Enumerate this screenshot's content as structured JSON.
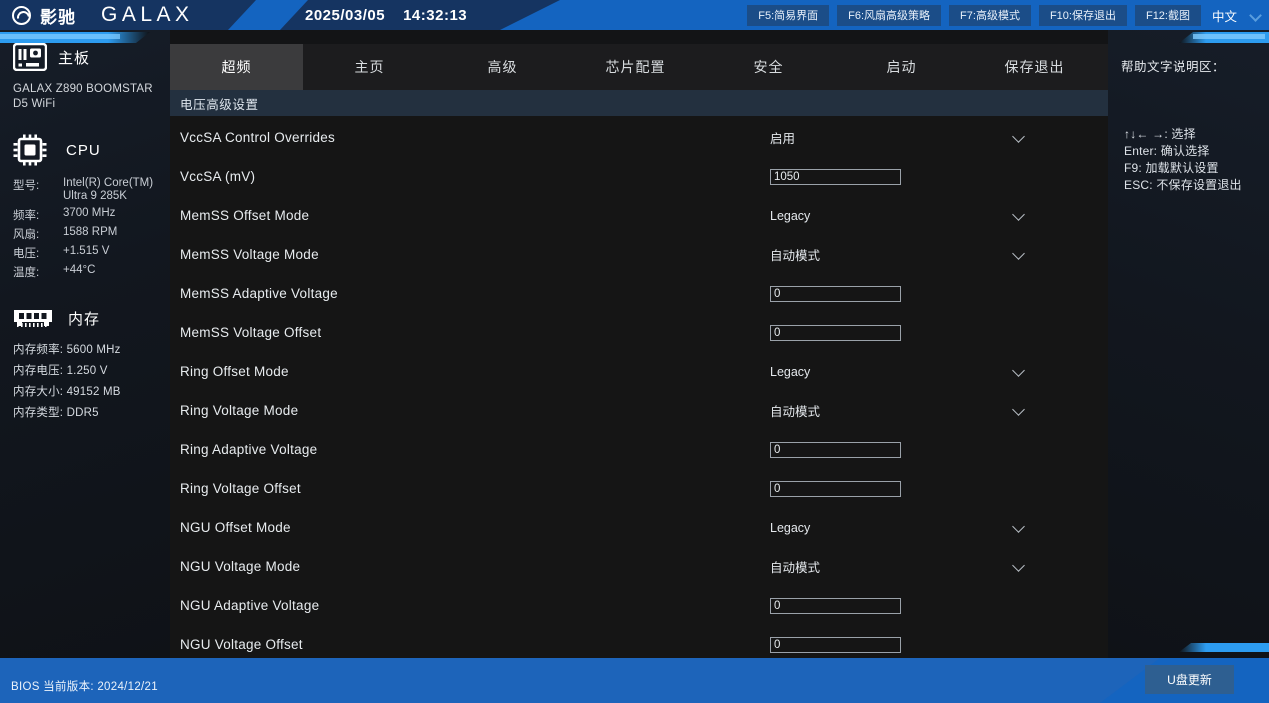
{
  "topbar": {
    "brand_cn": "影驰",
    "brand_en": "GALAX",
    "date": "2025/03/05",
    "time": "14:32:13",
    "fkeys": [
      {
        "label": "F5:简易界面"
      },
      {
        "label": "F6:风扇高级策略"
      },
      {
        "label": "F7:高级模式"
      },
      {
        "label": "F10:保存退出"
      },
      {
        "label": "F12:截图"
      }
    ],
    "language": "中文"
  },
  "sidebar": {
    "motherboard": {
      "title": "主板",
      "model": "GALAX Z890 BOOMSTAR D5 WiFi"
    },
    "cpu": {
      "title": "CPU",
      "rows": [
        {
          "key": "型号:",
          "value": "Intel(R) Core(TM) Ultra 9 285K"
        },
        {
          "key": "频率:",
          "value": "3700 MHz"
        },
        {
          "key": "风扇:",
          "value": "1588 RPM"
        },
        {
          "key": "电压:",
          "value": "+1.515 V"
        },
        {
          "key": "温度:",
          "value": "+44°C"
        }
      ]
    },
    "memory": {
      "title": "内存",
      "rows": [
        "内存频率: 5600 MHz",
        "内存电压: 1.250 V",
        "内存大小: 49152 MB",
        "内存类型: DDR5"
      ]
    }
  },
  "tabs": [
    {
      "label": "超频",
      "active": true
    },
    {
      "label": "主页",
      "active": false
    },
    {
      "label": "高级",
      "active": false
    },
    {
      "label": "芯片配置",
      "active": false
    },
    {
      "label": "安全",
      "active": false
    },
    {
      "label": "启动",
      "active": false
    },
    {
      "label": "保存退出",
      "active": false
    }
  ],
  "content": {
    "section_title": "电压高级设置",
    "rows": [
      {
        "label": "VccSA Control Overrides",
        "type": "select",
        "value": "启用"
      },
      {
        "label": "VccSA (mV)",
        "type": "text",
        "value": "1050"
      },
      {
        "label": "MemSS Offset Mode",
        "type": "select",
        "value": "Legacy"
      },
      {
        "label": "MemSS Voltage Mode",
        "type": "select",
        "value": "自动模式"
      },
      {
        "label": "MemSS Adaptive Voltage",
        "type": "text",
        "value": "0"
      },
      {
        "label": "MemSS Voltage Offset",
        "type": "text",
        "value": "0"
      },
      {
        "label": "Ring Offset Mode",
        "type": "select",
        "value": "Legacy"
      },
      {
        "label": "Ring Voltage Mode",
        "type": "select",
        "value": "自动模式"
      },
      {
        "label": "Ring Adaptive Voltage",
        "type": "text",
        "value": "0"
      },
      {
        "label": "Ring Voltage Offset",
        "type": "text",
        "value": "0"
      },
      {
        "label": "NGU Offset Mode",
        "type": "select",
        "value": "Legacy"
      },
      {
        "label": "NGU Voltage Mode",
        "type": "select",
        "value": "自动模式"
      },
      {
        "label": "NGU Adaptive Voltage",
        "type": "text",
        "value": "0"
      },
      {
        "label": "NGU Voltage Offset",
        "type": "text",
        "value": "0"
      }
    ]
  },
  "help": {
    "title": "帮助文字说明区：",
    "keys": [
      "↑↓← →: 选择",
      "Enter: 确认选择",
      "F9: 加载默认设置",
      "ESC: 不保存设置退出"
    ]
  },
  "bottom": {
    "bios_version": "BIOS 当前版本: 2024/12/21",
    "usb_update": "U盘更新"
  },
  "colors": {
    "accent_blue": "#1464c0",
    "panel_dark": "#151515",
    "section_header": "#23303f",
    "tab_active": "#3b3b3d"
  }
}
